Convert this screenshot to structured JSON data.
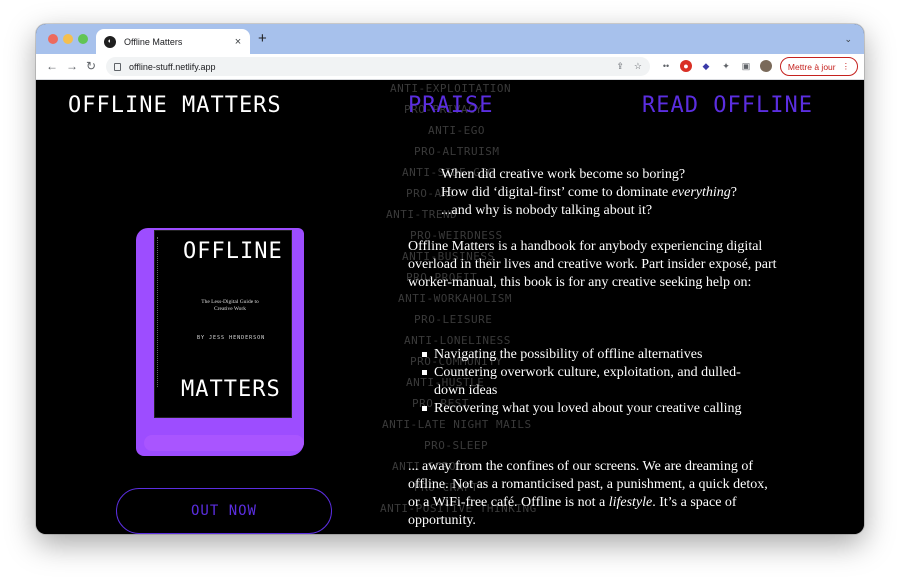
{
  "browser": {
    "tab_title": "Offline Matters",
    "tab_close": "×",
    "new_tab": "+",
    "tab_menu": "⌄",
    "url": "offline-stuff.netlify.app",
    "update_label": "Mettre à jour",
    "extension_badge": "4"
  },
  "site": {
    "title": "OFFLINE MATTERS",
    "nav": {
      "praise": "PRAISE",
      "read": "READ OFFLINE"
    },
    "cta": "OUT NOW",
    "accent_color": "#5b2ee0",
    "glow_color": "#9d4dff"
  },
  "background_words": [
    "ANTI-EXPLOITATION",
    "PRO-PRIVACY",
    "ANTI-EGO",
    "PRO-ALTRUISM",
    "ANTI-SIDE-GIG",
    "PRO-ART",
    "ANTI-TREND",
    "PRO-WEIRDNESS",
    "ANTI-BUSINESS",
    "PRO-PROFIT",
    "ANTI-WORKAHOLISM",
    "PRO-LEISURE",
    "ANTI-LONELINESS",
    "PRO-COMMUNITY",
    "ANTI-HUSTLE",
    "PRO-REST",
    "ANTI-LATE NIGHT MAILS",
    "PRO-SLEEP",
    "ANTI-SCROLL",
    "PRO-CRAFT",
    "ANTI-POSITIVE THINKING"
  ],
  "book": {
    "title_top": "OFFLINE",
    "subtitle": "The Less-Digital Guide to Creative Work",
    "author": "BY JESS HENDERSON",
    "title_bottom": "MATTERS"
  },
  "content": {
    "intro": [
      "When did creative work become so boring?",
      "How did ‘digital-first’ come to dominate",
      "everything",
      "?",
      "...and why is nobody talking about it?"
    ],
    "paragraph1": "Offline Matters is a handbook for anybody experiencing digital overload in their lives and creative work. Part insider exposé, part worker-manual, this book is for any creative seeking help on:",
    "bullets": [
      "Navigating the possibility of offline alternatives",
      "Countering overwork culture, exploitation, and dulled-down ideas",
      "Recovering what you loved about your creative calling"
    ],
    "paragraph2_a": "... away from the confines of our screens. We are dreaming of offline. Not as a romanticised past, a punishment, a quick detox, or a WiFi-free café. Offline is not a ",
    "paragraph2_em": "lifestyle",
    "paragraph2_b": ". It’s a space of opportunity."
  }
}
